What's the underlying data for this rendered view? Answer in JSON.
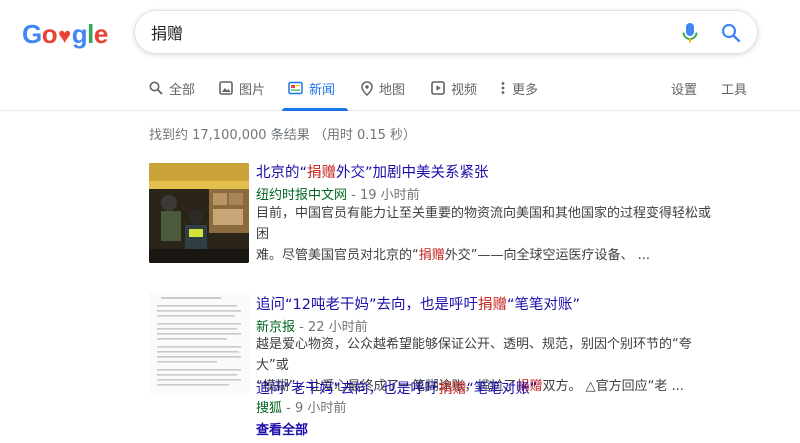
{
  "search": {
    "query": "捐赠"
  },
  "tabs": [
    {
      "label": "全部",
      "icon": "search-icon"
    },
    {
      "label": "图片",
      "icon": "image-icon"
    },
    {
      "label": "新闻",
      "icon": "news-icon"
    },
    {
      "label": "地图",
      "icon": "location-pin-icon"
    },
    {
      "label": "视频",
      "icon": "play-icon"
    },
    {
      "label": "更多",
      "icon": "vertical-dots-icon"
    }
  ],
  "tools": {
    "settings": "设置",
    "tools": "工具"
  },
  "stats": "找到约 17,100,000 条结果 （用时 0.15 秒）",
  "results": [
    {
      "title_pre": "北京的“",
      "title_hl": "捐赠",
      "title_post": "外交”加剧中美关系紧张",
      "source": "纽约时报中文网",
      "time": " - 19 小时前",
      "snippet_line1": "目前，中国官员有能力让至关重要的物资流向美国和其他国家的过程变得轻松或困",
      "snippet_line2_pre": "难。尽管美国官员对北京的“",
      "snippet_line2_hl": "捐赠",
      "snippet_line2_post": "外交”——向全球空运医疗设备、 ..."
    },
    {
      "title_pre": "追问“12吨老干妈”去向，也是呼吁",
      "title_hl": "捐赠",
      "title_post": "“笔笔对账”",
      "source": "新京报",
      "time": " - 22 小时前",
      "snippet_line1": "越是爱心物资，公众越希望能够保证公开、透明、规范，别因个别环节的“夸大”或",
      "snippet_line2_pre": "“模糊”，让爱心最终成了一笔糊涂账，尴尬了",
      "snippet_line2_hl": "捐赠",
      "snippet_line2_post": "双方。 △官方回应“老 ..."
    },
    {
      "title_pre": "追问“老干妈”去向，也是呼吁",
      "title_hl": "捐赠",
      "title_post": "“笔笔对账”",
      "source": "搜狐",
      "time": " - 9 小时前"
    }
  ],
  "see_all": "查看全部",
  "colors": {
    "link": "#1a0dab",
    "highlight": "#c5221f",
    "source": "#006621",
    "accent": "#1a73e8"
  }
}
